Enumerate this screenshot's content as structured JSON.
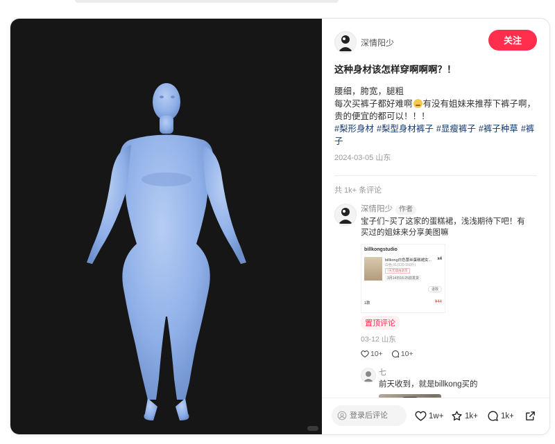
{
  "author": {
    "name": "深情阳少",
    "follow_label": "关注"
  },
  "post": {
    "title": "这种身材该怎样穿啊啊啊？！",
    "body_line1": "腰细，胯宽，腿粗",
    "body_line2a": "每次买裤子都好难啊",
    "body_line2b": "有没有姐妹来推荐下裤子啊，贵的便宜的都可以！！！",
    "tags": [
      "#梨形身材",
      "#梨型身材裤子",
      "#显瘦裤子",
      "#裤子种草",
      "#裤子"
    ],
    "date_location": "2024-03-05 山东"
  },
  "comments": {
    "count_label": "共 1k+ 条评论",
    "items": [
      {
        "name": "深情阳少",
        "badge": "作者",
        "text": "宝子们~买了这家的蛋糕裙，浅浅期待下吧！有买过的姐妹来分享美图嘛",
        "image": {
          "shop": "billkongstudio",
          "product": "billkong白色蕾丝蛋糕裙女...",
          "qty": "x4",
          "variant": "白色;XL(120-150斤)",
          "tag": "7天无理由退货",
          "ship": "3月14日16:25前发货",
          "btn": "退款",
          "label_left": "1款",
          "price": "¥44"
        },
        "pinned_label": "置顶评论",
        "date_location": "03-12 山东",
        "likes": "10+",
        "replies": "10+"
      }
    ],
    "reply": {
      "name": "七",
      "text": "前天收到，就是billkong买的"
    }
  },
  "bottom_bar": {
    "input_placeholder": "登录后评论",
    "likes": "1w+",
    "collects": "1k+",
    "comments": "1k+"
  },
  "colors": {
    "accent": "#ff2e4d",
    "tag": "#13386c",
    "media_bg": "#161616",
    "figure": "#8fb0e8"
  },
  "icons": [
    "heart-icon",
    "star-icon",
    "comment-icon",
    "share-icon",
    "user-icon"
  ]
}
